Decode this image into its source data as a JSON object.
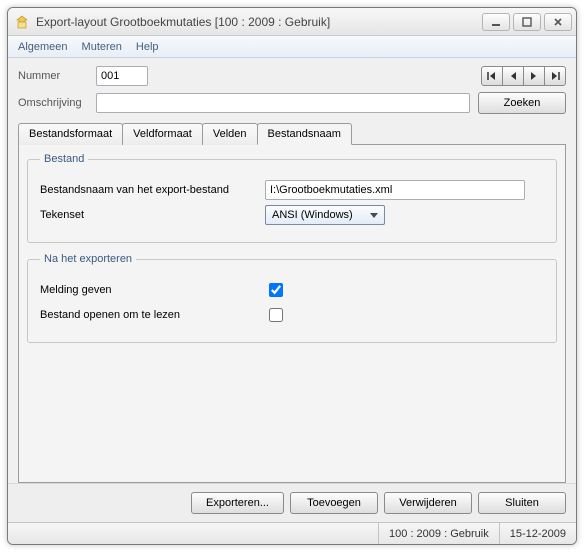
{
  "window": {
    "title": "Export-layout Grootboekmutaties  [100 : 2009 : Gebruik]"
  },
  "menu": {
    "algemeen": "Algemeen",
    "muteren": "Muteren",
    "help": "Help"
  },
  "top": {
    "nummer_label": "Nummer",
    "nummer_value": "001",
    "omschrijving_label": "Omschrijving",
    "omschrijving_value": "",
    "zoeken": "Zoeken"
  },
  "tabs": {
    "bestandsformaat": "Bestandsformaat",
    "veldformaat": "Veldformaat",
    "velden": "Velden",
    "bestandsnaam": "Bestandsnaam"
  },
  "file_group": {
    "legend": "Bestand",
    "path_label": "Bestandsnaam van het export-bestand",
    "path_value": "I:\\Grootboekmutaties.xml",
    "tekenset_label": "Tekenset",
    "tekenset_value": "ANSI (Windows)"
  },
  "after_group": {
    "legend": "Na het exporteren",
    "melding_label": "Melding geven",
    "melding_checked": true,
    "open_label": "Bestand openen om te lezen",
    "open_checked": false
  },
  "buttons": {
    "exporteren": "Exporteren...",
    "toevoegen": "Toevoegen",
    "verwijderen": "Verwijderen",
    "sluiten": "Sluiten"
  },
  "status": {
    "context": "100 : 2009 : Gebruik",
    "date": "15-12-2009"
  }
}
